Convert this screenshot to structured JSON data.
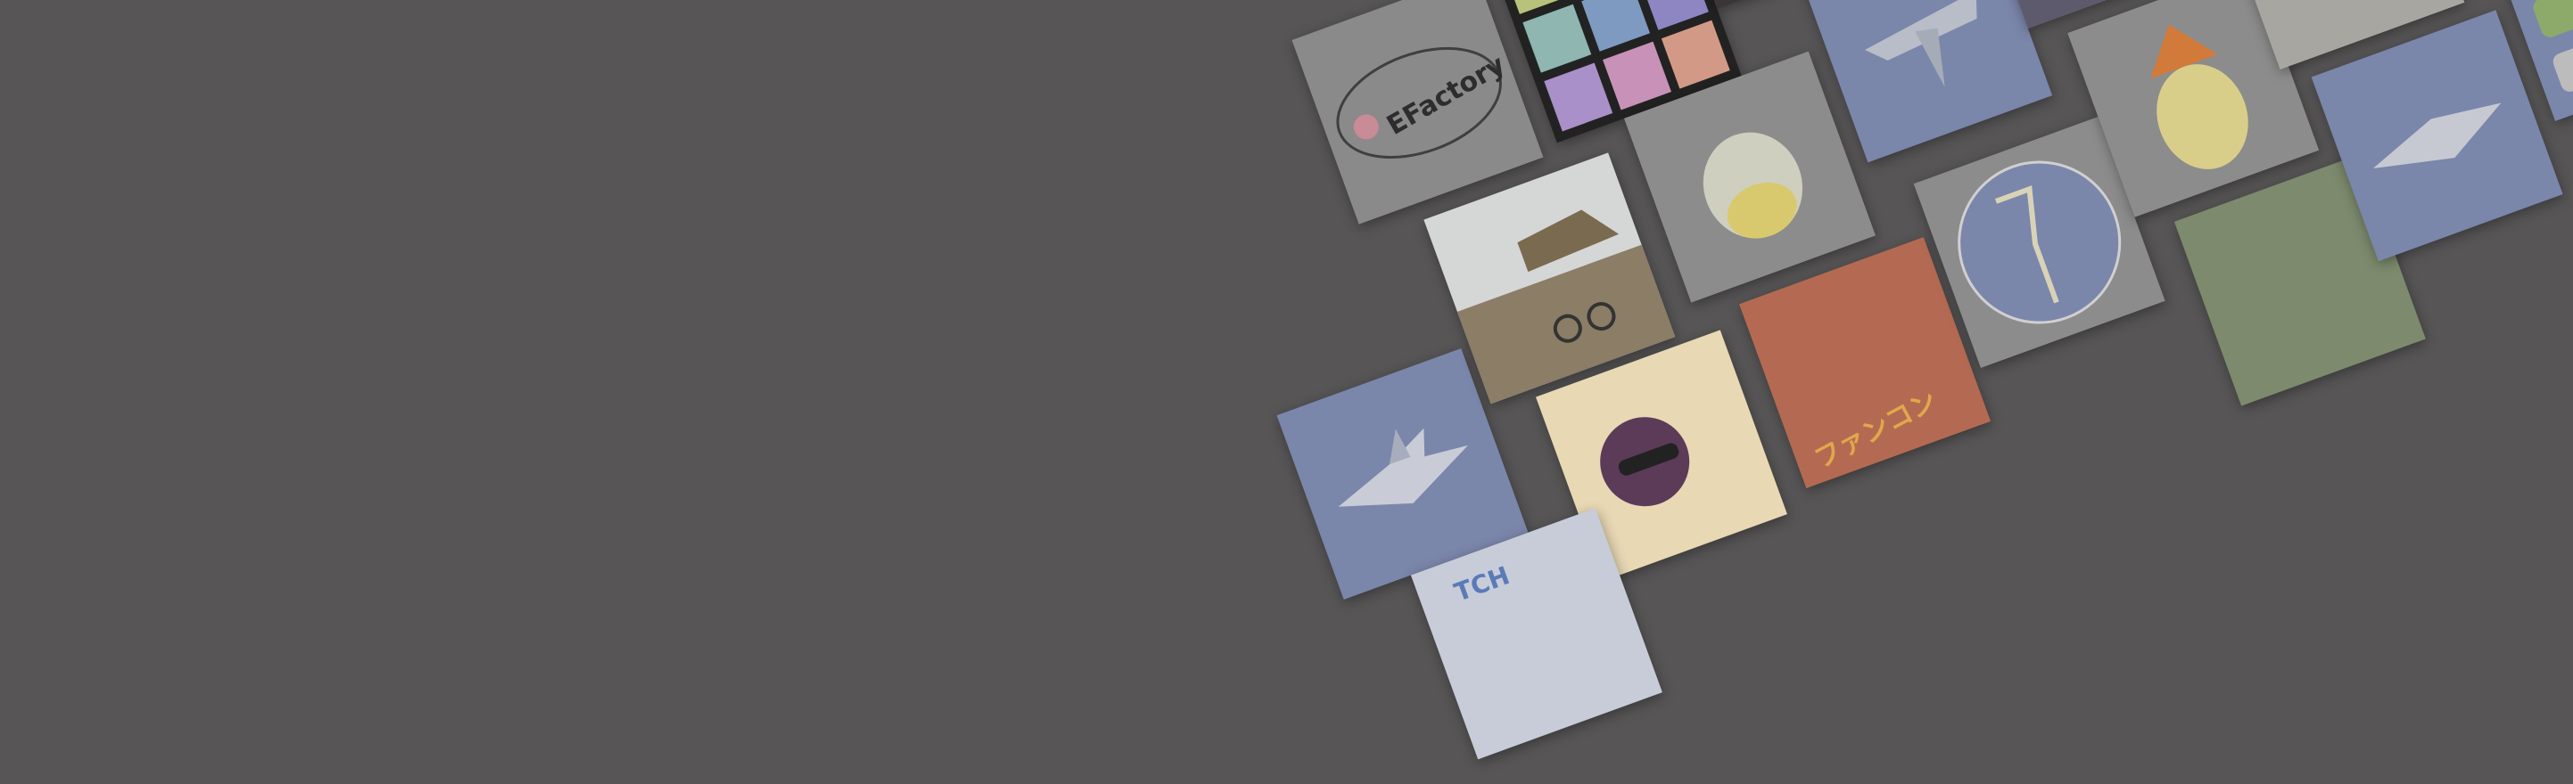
{
  "tile_labels": {
    "efactory": "EFactory",
    "katakana": "ファンコン",
    "watch": "TCH"
  },
  "colors": {
    "background": "#575556",
    "tile_blue": "#7b86ab",
    "tile_grey": "#8c8c8c",
    "tile_dark": "#3b3536"
  }
}
